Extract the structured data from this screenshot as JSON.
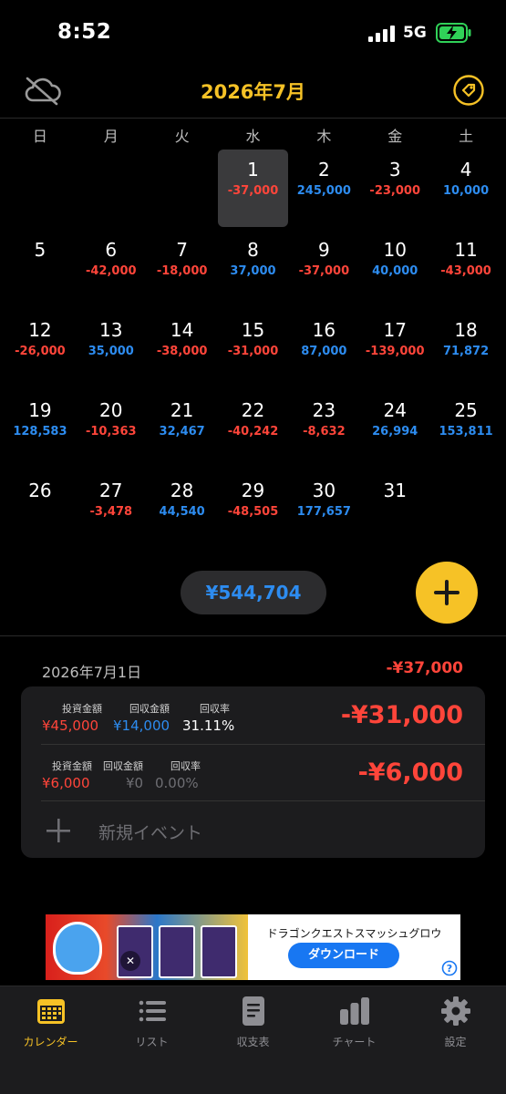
{
  "status_bar": {
    "time": "8:52",
    "network": "5G"
  },
  "header": {
    "title": "2026年7月"
  },
  "weekdays": [
    "日",
    "月",
    "火",
    "水",
    "木",
    "金",
    "土"
  ],
  "calendar": {
    "cells": [
      {
        "day": "",
        "amount": "",
        "sign": ""
      },
      {
        "day": "",
        "amount": "",
        "sign": ""
      },
      {
        "day": "",
        "amount": "",
        "sign": ""
      },
      {
        "day": "1",
        "amount": "-37,000",
        "sign": "neg",
        "selected": true
      },
      {
        "day": "2",
        "amount": "245,000",
        "sign": "pos"
      },
      {
        "day": "3",
        "amount": "-23,000",
        "sign": "neg"
      },
      {
        "day": "4",
        "amount": "10,000",
        "sign": "pos"
      },
      {
        "day": "5",
        "amount": "",
        "sign": ""
      },
      {
        "day": "6",
        "amount": "-42,000",
        "sign": "neg"
      },
      {
        "day": "7",
        "amount": "-18,000",
        "sign": "neg"
      },
      {
        "day": "8",
        "amount": "37,000",
        "sign": "pos"
      },
      {
        "day": "9",
        "amount": "-37,000",
        "sign": "neg"
      },
      {
        "day": "10",
        "amount": "40,000",
        "sign": "pos"
      },
      {
        "day": "11",
        "amount": "-43,000",
        "sign": "neg"
      },
      {
        "day": "12",
        "amount": "-26,000",
        "sign": "neg"
      },
      {
        "day": "13",
        "amount": "35,000",
        "sign": "pos"
      },
      {
        "day": "14",
        "amount": "-38,000",
        "sign": "neg"
      },
      {
        "day": "15",
        "amount": "-31,000",
        "sign": "neg"
      },
      {
        "day": "16",
        "amount": "87,000",
        "sign": "pos"
      },
      {
        "day": "17",
        "amount": "-139,000",
        "sign": "neg"
      },
      {
        "day": "18",
        "amount": "71,872",
        "sign": "pos"
      },
      {
        "day": "19",
        "amount": "128,583",
        "sign": "pos"
      },
      {
        "day": "20",
        "amount": "-10,363",
        "sign": "neg"
      },
      {
        "day": "21",
        "amount": "32,467",
        "sign": "pos"
      },
      {
        "day": "22",
        "amount": "-40,242",
        "sign": "neg"
      },
      {
        "day": "23",
        "amount": "-8,632",
        "sign": "neg"
      },
      {
        "day": "24",
        "amount": "26,994",
        "sign": "pos"
      },
      {
        "day": "25",
        "amount": "153,811",
        "sign": "pos"
      },
      {
        "day": "26",
        "amount": "",
        "sign": ""
      },
      {
        "day": "27",
        "amount": "-3,478",
        "sign": "neg"
      },
      {
        "day": "28",
        "amount": "44,540",
        "sign": "pos"
      },
      {
        "day": "29",
        "amount": "-48,505",
        "sign": "neg"
      },
      {
        "day": "30",
        "amount": "177,657",
        "sign": "pos"
      },
      {
        "day": "31",
        "amount": "",
        "sign": ""
      }
    ]
  },
  "month_total": "¥544,704",
  "selected_day": {
    "date": "2026年7月1日",
    "total": "-¥37,000",
    "events": [
      {
        "invest_label": "投資金額",
        "invest_value": "¥45,000",
        "return_label": "回収金額",
        "return_value": "¥14,000",
        "rate_label": "回収率",
        "rate_value": "31.11%",
        "amount": "-¥31,000"
      },
      {
        "invest_label": "投資金額",
        "invest_value": "¥6,000",
        "return_label": "回収金額",
        "return_value": "¥0",
        "rate_label": "回収率",
        "rate_value": "0.00%",
        "amount": "-¥6,000"
      }
    ],
    "new_event_label": "新規イベント"
  },
  "ad": {
    "title": "ドラゴンクエストスマッシュグロウ",
    "button": "ダウンロード"
  },
  "tabs": [
    {
      "label": "カレンダー",
      "icon": "calendar-icon",
      "active": true
    },
    {
      "label": "リスト",
      "icon": "list-icon",
      "active": false
    },
    {
      "label": "収支表",
      "icon": "document-icon",
      "active": false
    },
    {
      "label": "チャート",
      "icon": "bar-chart-icon",
      "active": false
    },
    {
      "label": "設定",
      "icon": "gear-icon",
      "active": false
    }
  ],
  "colors": {
    "accent": "#f6c226",
    "negative": "#ff453a",
    "positive": "#2d8cf0",
    "background": "#000000"
  }
}
